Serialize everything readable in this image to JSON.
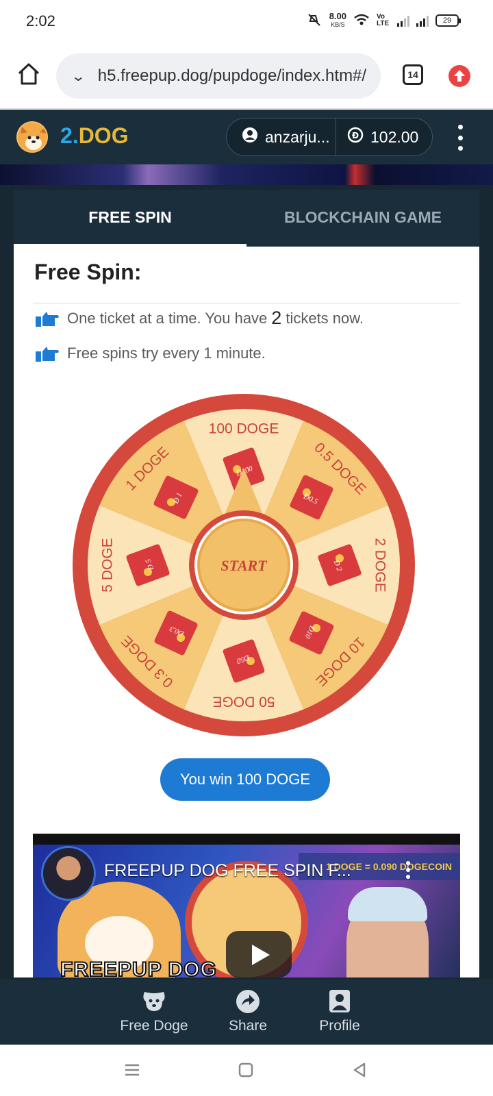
{
  "status_bar": {
    "time": "2:02",
    "net_speed": "8.00",
    "net_unit": "KB/S",
    "volte": "Vo LTE",
    "battery": "29"
  },
  "browser": {
    "url": "h5.freepup.dog/pupdoge/index.htm#/",
    "tab_count": "14"
  },
  "header": {
    "brand_part1": "2.",
    "brand_part2": "DOG",
    "username": "anzarju...",
    "balance": "102.00"
  },
  "tabs": {
    "free_spin": "FREE SPIN",
    "blockchain_game": "BLOCKCHAIN GAME"
  },
  "content": {
    "title": "Free Spin:",
    "info1_before": "One ticket at a time. You have",
    "tickets": "2",
    "info1_after": "tickets now.",
    "info2": "Free spins try every 1 minute."
  },
  "wheel": {
    "start_label": "START",
    "segments": [
      {
        "label": "100 DOGE",
        "envelope": "Đ100"
      },
      {
        "label": "0.5 DOGE",
        "envelope": "Đ0.5"
      },
      {
        "label": "2 DOGE",
        "envelope": "Đ 2"
      },
      {
        "label": "10 DOGE",
        "envelope": "Đ10"
      },
      {
        "label": "50 DOGE",
        "envelope": "Đ50"
      },
      {
        "label": "0.3 DOGE",
        "envelope": "Đ0.3"
      },
      {
        "label": "5 DOGE",
        "envelope": "Đ 5"
      },
      {
        "label": "1 DOGE",
        "envelope": "Đ 1"
      }
    ],
    "colors": {
      "rim": "#d4493b",
      "light": "#fbe5b8",
      "dark": "#f5c978",
      "hub": "#f3c06a",
      "text": "#c8443a"
    }
  },
  "win_button": "You win 100 DOGE",
  "video": {
    "title": "FREEPUP DOG FREE SPIN F...",
    "ticker": "1 DOGE = 0.090 DOGECOIN",
    "brand_text": "FREEPUP DOG"
  },
  "bottom_nav": {
    "free_doge": "Free Doge",
    "share": "Share",
    "profile": "Profile"
  },
  "icons": [
    "home-icon",
    "chevron-down-icon",
    "upload-icon",
    "user-icon",
    "doge-coin-icon",
    "kebab-menu-icon",
    "thumbs-point-icon",
    "play-icon",
    "dog-icon",
    "share-icon",
    "profile-icon",
    "recents-icon",
    "home-nav-icon",
    "back-icon"
  ]
}
